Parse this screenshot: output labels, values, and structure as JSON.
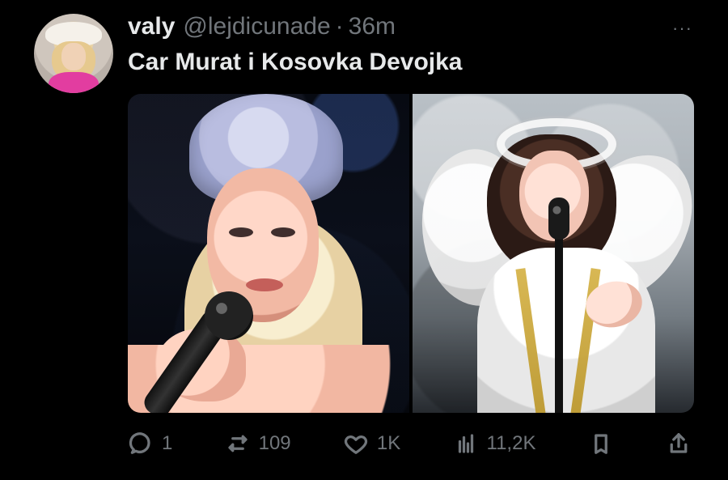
{
  "tweet": {
    "display_name": "valy",
    "handle": "@lejdicunade",
    "separator": "·",
    "time": "36m",
    "more_label": "···",
    "text": "Car Murat i Kosovka Devojka"
  },
  "actions": {
    "reply_count": "1",
    "retweet_count": "109",
    "like_count": "1K",
    "views_count": "11,2K"
  },
  "icons": {
    "reply": "reply-icon",
    "retweet": "retweet-icon",
    "like": "heart-icon",
    "views": "views-icon",
    "bookmark": "bookmark-icon",
    "share": "share-icon"
  }
}
